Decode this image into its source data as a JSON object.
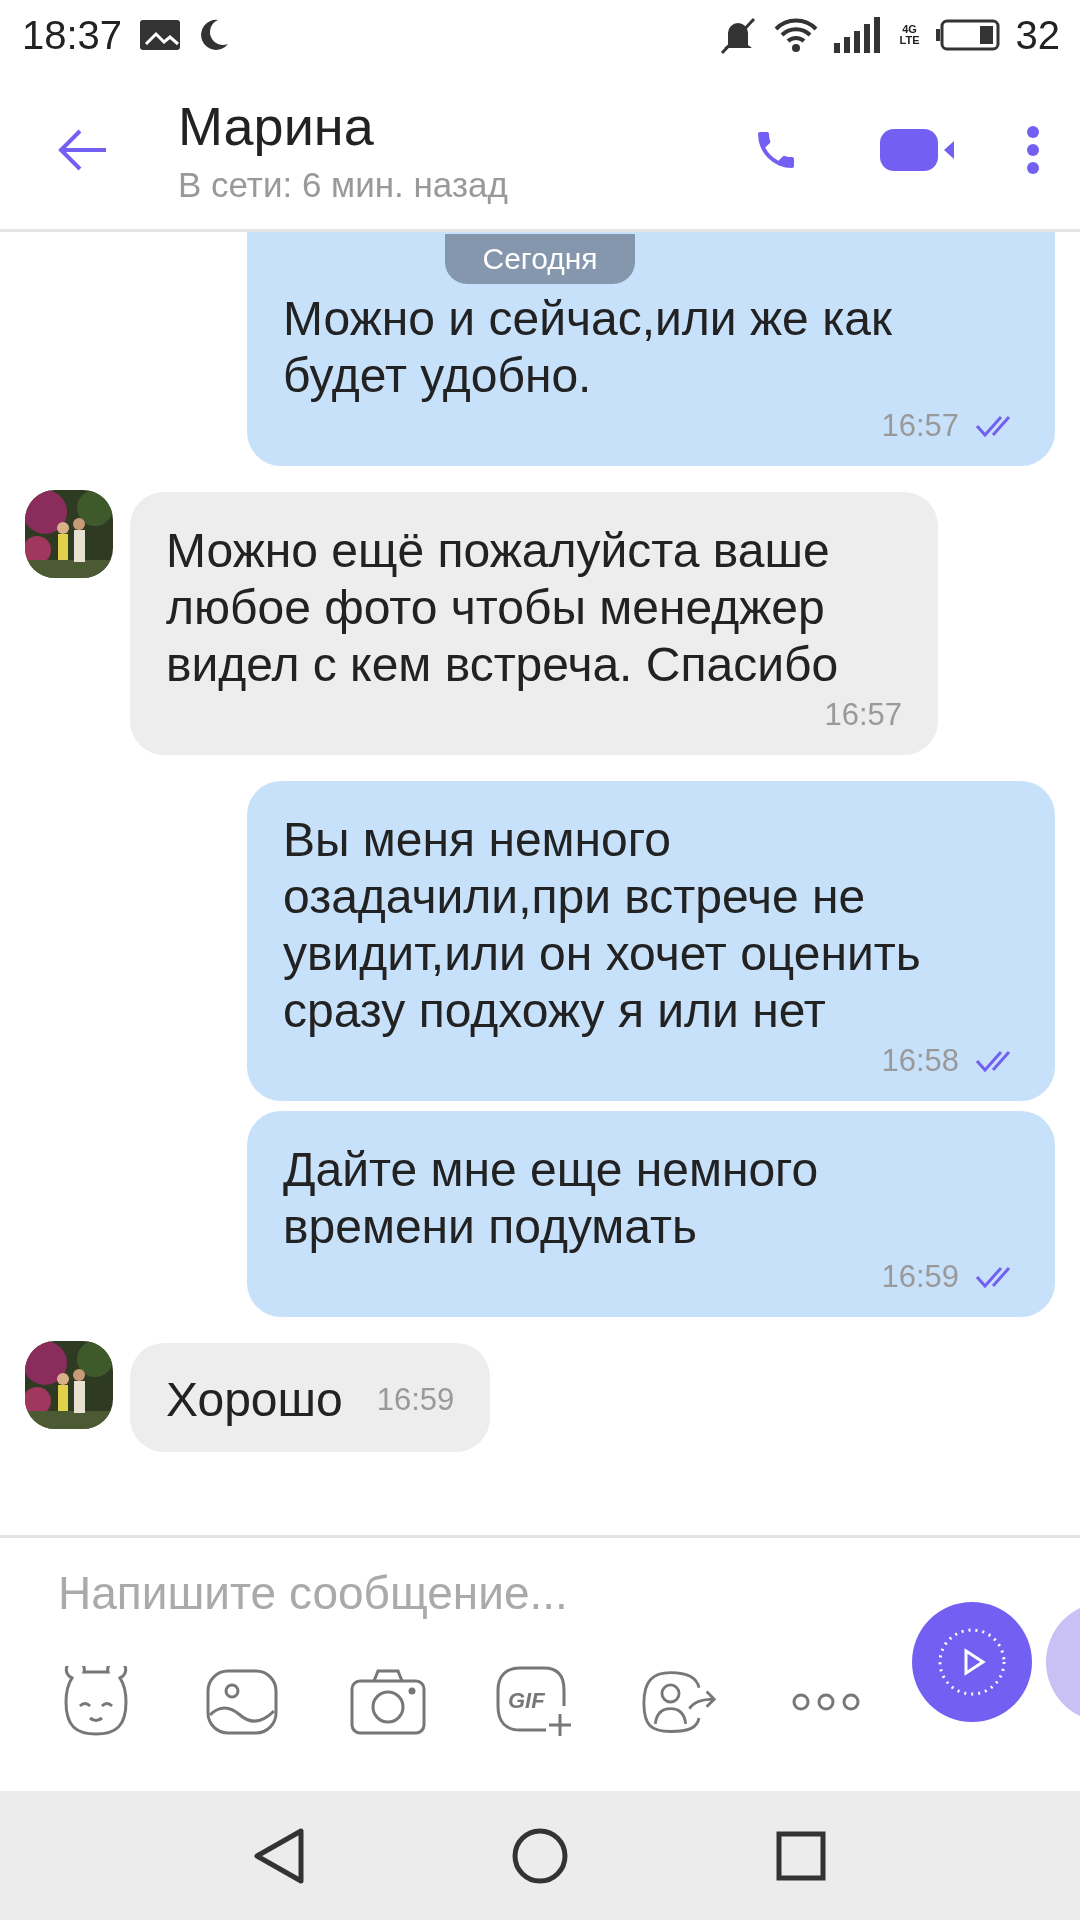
{
  "status_bar": {
    "time": "18:37",
    "network": [
      "4G",
      "LTE"
    ],
    "battery": "32"
  },
  "header": {
    "title": "Марина",
    "subtitle": "В сети: 6 мин. назад"
  },
  "date_chip": "Сегодня",
  "messages": [
    {
      "kind": "outgoing",
      "text": "Можно и сейчас,или же как будет удобно.",
      "time": "16:57",
      "read": true
    },
    {
      "kind": "incoming",
      "text": "Можно ещё пожалуйста ваше любое фото чтобы менеджер видел с кем встреча. Спасибо",
      "time": "16:57"
    },
    {
      "kind": "outgoing",
      "text": "Вы меня немного озадачили,при встрече не увидит,или он хочет оценить сразу подхожу я или нет",
      "time": "16:58",
      "read": true
    },
    {
      "kind": "outgoing",
      "text": "Дайте мне еще немного времени подумать",
      "time": "16:59",
      "read": true
    },
    {
      "kind": "incoming",
      "text": "Хорошо",
      "time": "16:59",
      "inline_time": true
    }
  ],
  "composer": {
    "placeholder": "Напишите сообщение...",
    "gif_label": "GIF"
  }
}
